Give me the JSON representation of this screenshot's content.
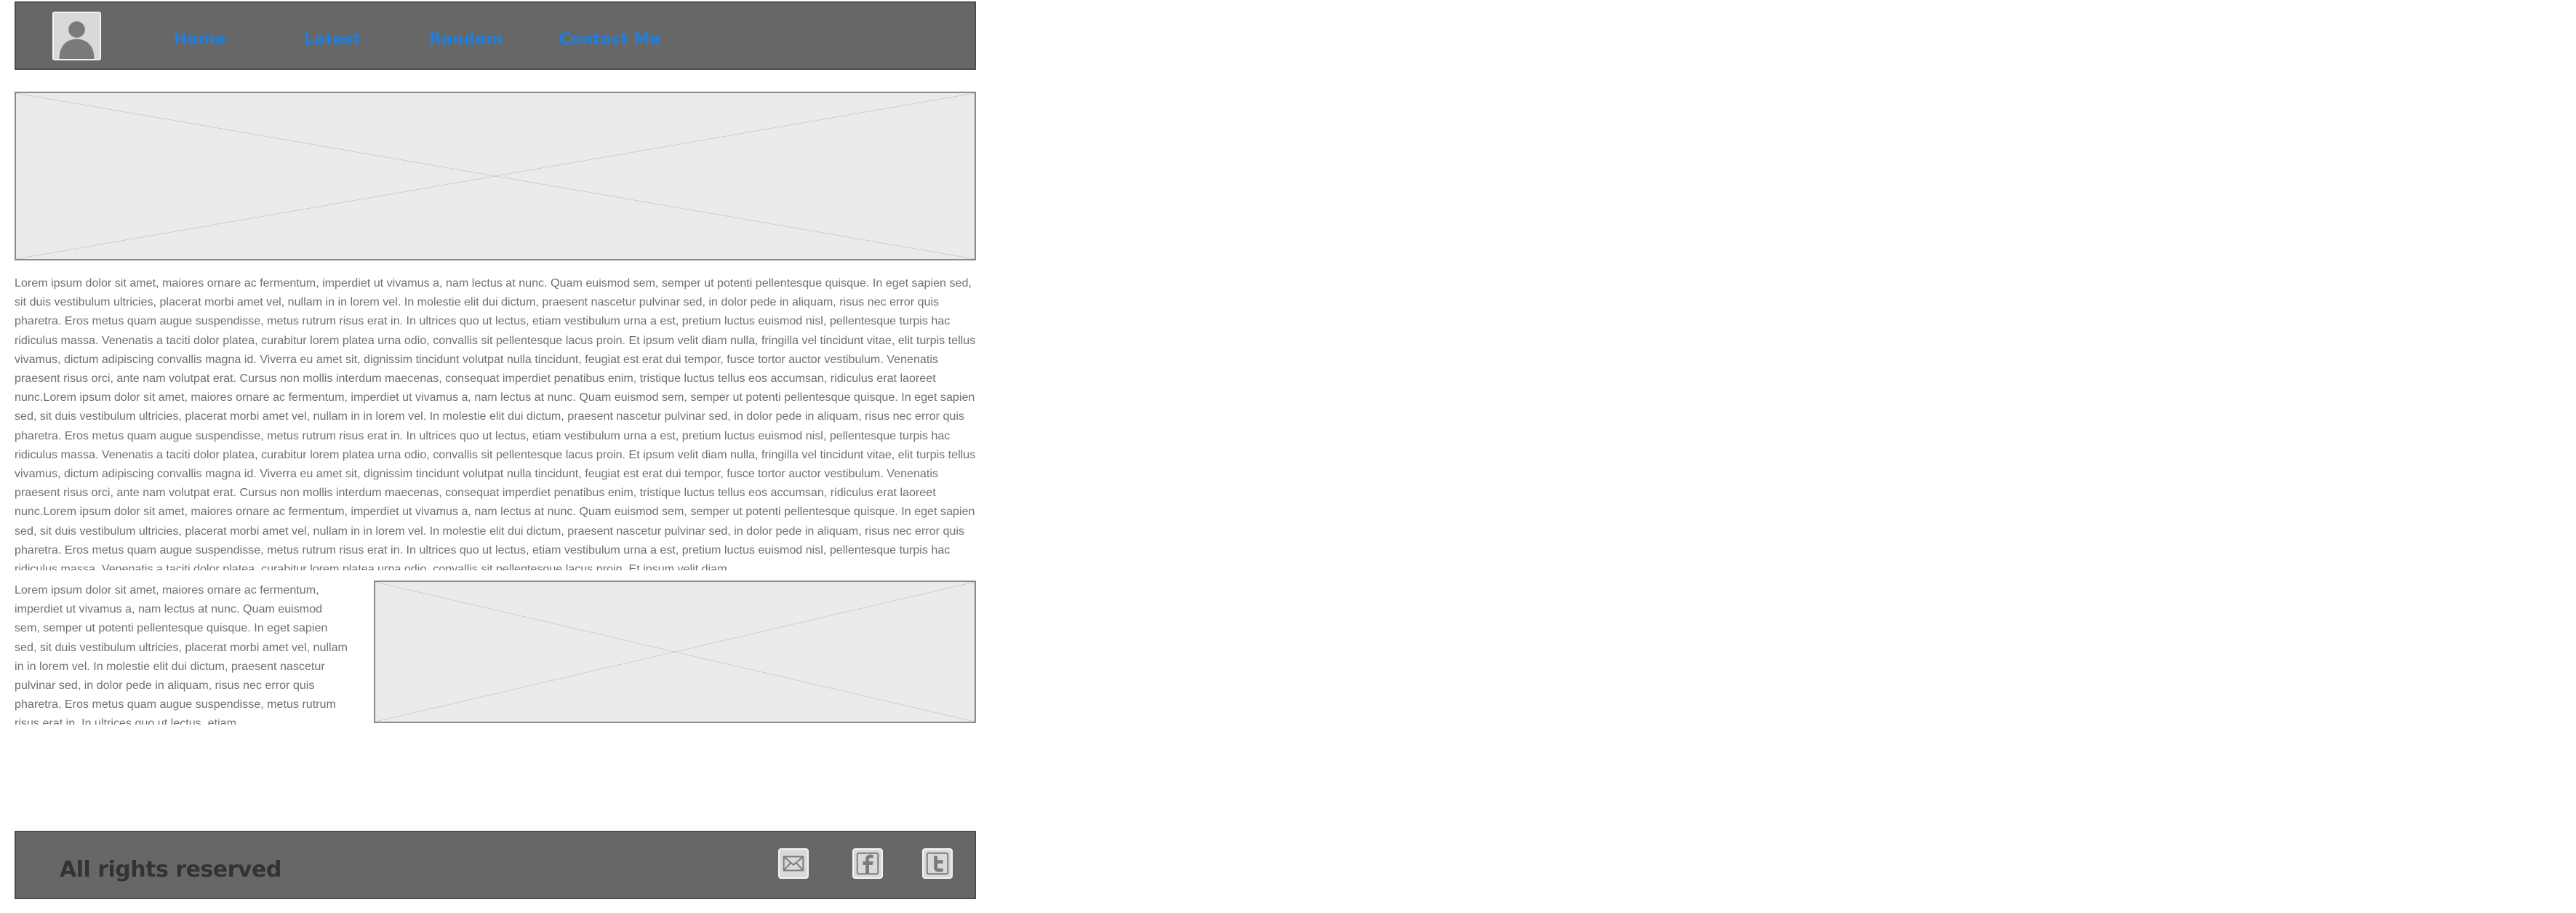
{
  "header": {
    "nav": [
      {
        "label": "Home"
      },
      {
        "label": "Latest"
      },
      {
        "label": "Random"
      },
      {
        "label": "Contact Me"
      }
    ]
  },
  "content": {
    "paragraph": "Lorem ipsum dolor sit amet, maiores ornare ac fermentum, imperdiet ut vivamus a, nam lectus at nunc. Quam euismod sem, semper ut potenti pellentesque quisque. In eget sapien sed, sit duis vestibulum ultricies, placerat morbi amet vel, nullam in in lorem vel. In molestie elit dui dictum, praesent nascetur pulvinar sed, in dolor pede in aliquam, risus nec error quis pharetra. Eros metus quam augue suspendisse, metus rutrum risus erat in.  In ultrices quo ut lectus, etiam vestibulum urna a est, pretium luctus euismod nisl, pellentesque turpis hac ridiculus massa. Venenatis a taciti dolor platea, curabitur lorem platea urna odio, convallis sit pellentesque lacus proin. Et ipsum velit diam nulla, fringilla vel tincidunt vitae, elit turpis tellus vivamus, dictum adipiscing convallis magna id. Viverra eu amet sit, dignissim tincidunt volutpat nulla tincidunt, feugiat est erat dui tempor, fusce tortor auctor vestibulum. Venenatis praesent risus orci, ante nam volutpat erat. Cursus non mollis interdum maecenas, consequat imperdiet penatibus enim, tristique luctus tellus eos accumsan, ridiculus erat laoreet nunc.Lorem ipsum dolor sit amet, maiores ornare ac fermentum, imperdiet ut vivamus a, nam lectus at nunc. Quam euismod sem, semper ut potenti pellentesque quisque. In eget sapien sed, sit duis vestibulum ultricies, placerat morbi amet vel, nullam in in lorem vel. In molestie elit dui dictum, praesent nascetur pulvinar sed, in dolor pede in aliquam, risus nec error quis pharetra. Eros metus quam augue suspendisse, metus rutrum risus erat in.  In ultrices quo ut lectus, etiam vestibulum urna a est, pretium luctus euismod nisl, pellentesque turpis hac ridiculus massa. Venenatis a taciti dolor platea, curabitur lorem platea urna odio, convallis sit pellentesque lacus proin. Et ipsum velit diam nulla, fringilla vel tincidunt vitae, elit turpis tellus vivamus, dictum adipiscing convallis magna id. Viverra eu amet sit, dignissim tincidunt volutpat nulla tincidunt, feugiat est erat dui tempor, fusce tortor auctor vestibulum. Venenatis praesent risus orci, ante nam volutpat erat. Cursus non mollis interdum maecenas, consequat imperdiet penatibus enim, tristique luctus tellus eos accumsan, ridiculus erat laoreet nunc.Lorem ipsum dolor sit amet, maiores ornare ac fermentum, imperdiet ut vivamus a, nam lectus at nunc. Quam euismod sem, semper ut potenti pellentesque quisque. In eget sapien sed, sit duis vestibulum ultricies, placerat morbi amet vel, nullam in in lorem vel. In molestie elit dui dictum, praesent nascetur pulvinar sed, in dolor pede in aliquam, risus nec error quis pharetra. Eros metus quam augue suspendisse, metus rutrum risus erat in.  In ultrices quo ut lectus, etiam vestibulum urna a est, pretium luctus euismod nisl, pellentesque turpis hac ridiculus massa. Venenatis a taciti dolor platea, curabitur lorem platea urna odio, convallis sit pellentesque lacus proin. Et ipsum velit diam",
    "column_text": "Lorem ipsum dolor sit amet, maiores ornare ac fermentum, imperdiet ut vivamus a, nam lectus at nunc. Quam euismod sem, semper ut potenti pellentesque quisque. In eget sapien sed, sit duis vestibulum ultricies, placerat morbi amet vel, nullam in in lorem vel. In molestie elit dui dictum, praesent nascetur pulvinar sed, in dolor pede in aliquam, risus nec error quis pharetra. Eros metus quam augue suspendisse, metus rutrum risus erat in.  In ultrices quo ut lectus, etiam"
  },
  "footer": {
    "text": "All rights reserved",
    "social": [
      {
        "icon": "mail-icon"
      },
      {
        "icon": "facebook-icon"
      },
      {
        "icon": "twitter-icon"
      }
    ]
  },
  "colors": {
    "bar_background": "#676767",
    "nav_link": "#1e7fe0",
    "placeholder_fill": "#ebebeb",
    "body_text": "#707070"
  }
}
